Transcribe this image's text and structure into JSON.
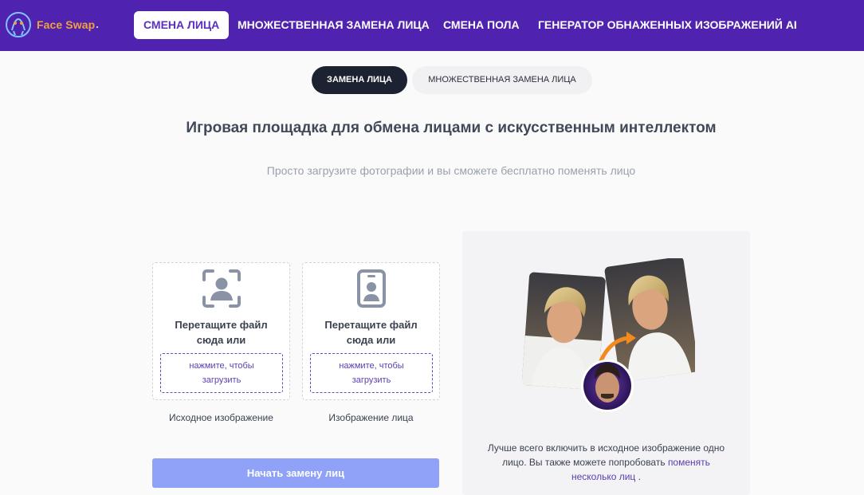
{
  "header": {
    "logo_text": "Face Swap",
    "nav": [
      {
        "label": "СМЕНА ЛИЦА",
        "active": true
      },
      {
        "label": "МНОЖЕСТВЕННАЯ ЗАМЕНА ЛИЦА",
        "active": false
      },
      {
        "label": "СМЕНА ПОЛА",
        "active": false
      },
      {
        "label": "ГЕНЕРАТОР ОБНАЖЕННЫХ ИЗОБРАЖЕНИЙ AI",
        "active": false
      }
    ]
  },
  "subtabs": [
    {
      "label": "ЗАМЕНА ЛИЦА",
      "active": true
    },
    {
      "label": "МНОЖЕСТВЕННАЯ ЗАМЕНА ЛИЦА",
      "active": false
    }
  ],
  "main": {
    "title": "Игровая площадка для обмена лицами с искусственным интеллектом",
    "subtitle": "Просто загрузите фотографии и вы сможете бесплатно поменять лицо"
  },
  "uploads": [
    {
      "icon": "face-scan-icon",
      "drop_line1": "Перетащите файл",
      "drop_line2": "сюда или",
      "click_line1": "нажмите, чтобы",
      "click_line2": "загрузить",
      "caption": "Исходное изображение"
    },
    {
      "icon": "id-badge-icon",
      "drop_line1": "Перетащите файл",
      "drop_line2": "сюда или",
      "click_line1": "нажмите, чтобы",
      "click_line2": "загрузить",
      "caption": "Изображение лица"
    }
  ],
  "start_button": "Начать замену лиц",
  "example": {
    "note_line1": "Лучше всего включить в исходное изображение одно",
    "note_line2_prefix": "лицо. Вы также можете попробовать",
    "link_part1": "поменять",
    "link_part2": "несколько лиц",
    "note_end": "."
  },
  "colors": {
    "header_bg": "#4f22b0",
    "accent": "#5b3fb0",
    "start_button_bg": "#8fa2f8",
    "dark_tab": "#1d2232",
    "logo_text": "#f2a03a"
  }
}
